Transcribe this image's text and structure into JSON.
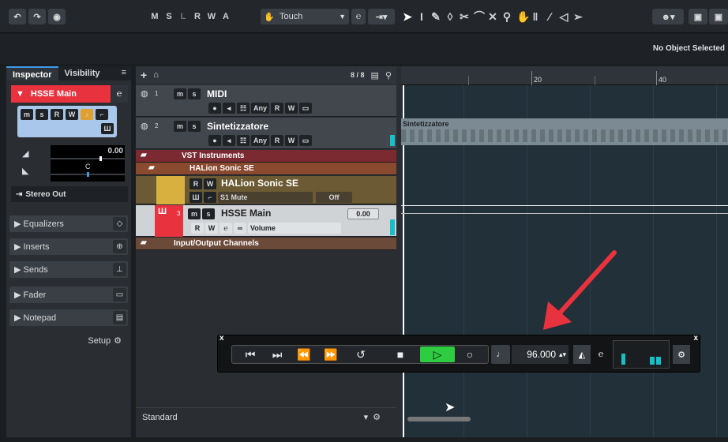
{
  "toolbar": {
    "modes": [
      "M",
      "S",
      "L",
      "R",
      "W",
      "A"
    ],
    "automation_mode": "Touch",
    "no_object_selected": "No Object Selected"
  },
  "inspector": {
    "tab_inspector": "Inspector",
    "tab_visibility": "Visibility",
    "track_name": "HSSE Main",
    "volume": "0.00",
    "pan": "C",
    "output": "Stereo Out",
    "sections": [
      "Equalizers",
      "Inserts",
      "Sends",
      "Fader",
      "Notepad"
    ],
    "setup": "Setup"
  },
  "tracklist": {
    "count": "8 / 8",
    "tracks": {
      "midi": {
        "num": "1",
        "name": "MIDI",
        "any": "Any"
      },
      "sint": {
        "num": "2",
        "name": "Sintetizzatore",
        "any": "Any"
      },
      "vst": {
        "name": "VST Instruments"
      },
      "halion_folder": {
        "name": "HALion Sonic SE"
      },
      "halion": {
        "name": "HALion Sonic SE",
        "mute_label": "S1 Mute",
        "mute_value": "Off"
      },
      "hsse": {
        "num": "3",
        "name": "HSSE Main",
        "vol": "0.00",
        "param": "Volume"
      },
      "io": {
        "name": "Input/Output Channels"
      }
    },
    "footer": "Standard"
  },
  "ruler": {
    "marks": [
      "20",
      "40"
    ],
    "clip_label": "Sintetizzatore"
  },
  "transport": {
    "tempo": "96.000"
  },
  "colors": {
    "accent": "#e8333f",
    "play": "#2ecc40",
    "meter": "#16c0c8"
  }
}
